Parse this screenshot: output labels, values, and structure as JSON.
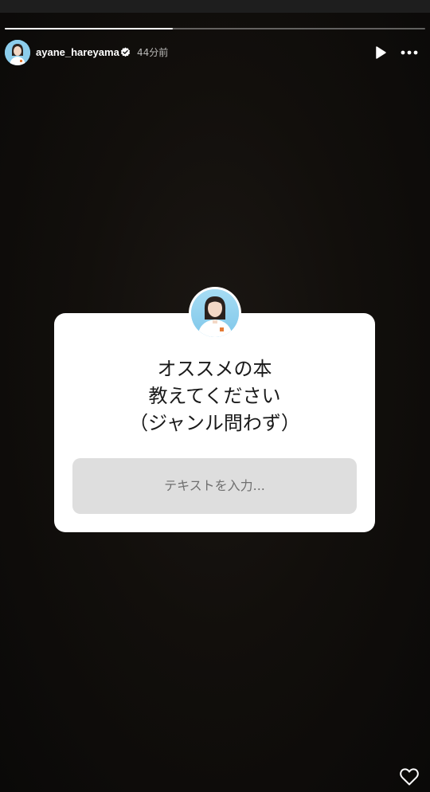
{
  "story": {
    "progress_fraction": 0.4,
    "username": "ayane_hareyama",
    "verified": true,
    "timestamp": "44分前"
  },
  "question_sticker": {
    "lines": [
      "オススメの本",
      "教えてください",
      "（ジャンル問わず）"
    ],
    "answer_placeholder": "テキストを入力..."
  },
  "icons": {
    "avatar": "profile-avatar-icon",
    "verified": "verified-badge-icon",
    "play": "play-icon",
    "more": "more-icon",
    "like": "heart-icon"
  },
  "colors": {
    "background": "#120f0c",
    "card": "#ffffff",
    "input": "#dedede",
    "avatar_bg": "#8fd0ee"
  }
}
